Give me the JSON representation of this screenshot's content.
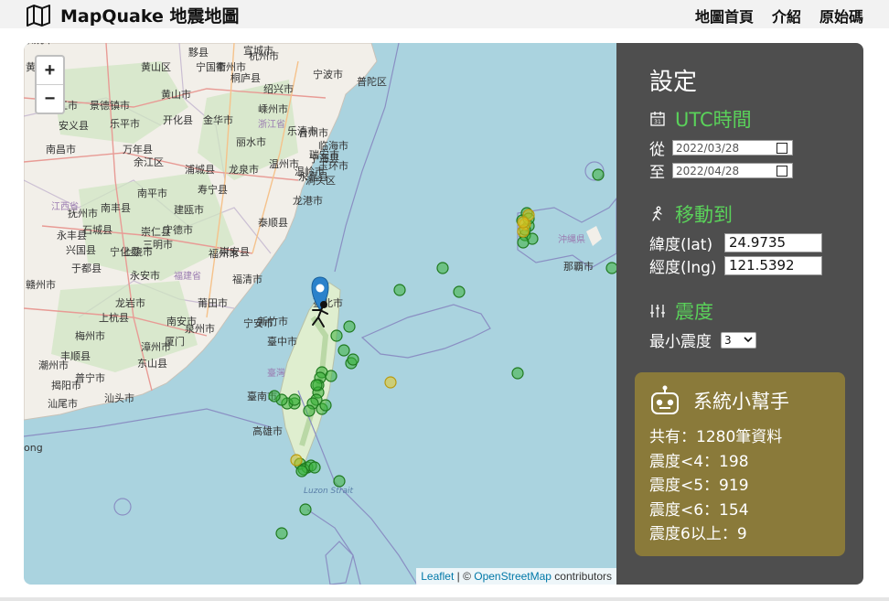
{
  "header": {
    "brand": "MapQuake 地震地圖",
    "nav": [
      "地圖首頁",
      "介紹",
      "原始碼"
    ]
  },
  "map": {
    "zoom_in": "+",
    "zoom_out": "−",
    "attribution": {
      "leaflet": "Leaflet",
      "sep": " | © ",
      "osm": "OpenStreetMap",
      "tail": " contributors"
    },
    "labels": [
      {
        "t": "黄",
        "k": "city"
      },
      {
        "t": "九江市",
        "k": "city"
      },
      {
        "t": "南昌市",
        "k": "city"
      },
      {
        "t": "抚州市",
        "k": "city"
      },
      {
        "t": "景德镇市",
        "k": "city"
      },
      {
        "t": "上饶市",
        "k": "city"
      },
      {
        "t": "南平市",
        "k": "city"
      },
      {
        "t": "宁德市",
        "k": "city"
      },
      {
        "t": "福州市",
        "k": "city"
      },
      {
        "t": "福清市",
        "k": "city"
      },
      {
        "t": "莆田市",
        "k": "city"
      },
      {
        "t": "泉州市",
        "k": "city"
      },
      {
        "t": "漳州市",
        "k": "city"
      },
      {
        "t": "厦门",
        "k": "city"
      },
      {
        "t": "龙岩市",
        "k": "city"
      },
      {
        "t": "三明市",
        "k": "city"
      },
      {
        "t": "梅州市",
        "k": "city"
      },
      {
        "t": "汕头市",
        "k": "city"
      },
      {
        "t": "汕尾市",
        "k": "city"
      },
      {
        "t": "揭阳市",
        "k": "city"
      },
      {
        "t": "赣州市",
        "k": "city"
      },
      {
        "t": "金华市",
        "k": "city"
      },
      {
        "t": "丽水市",
        "k": "city"
      },
      {
        "t": "温州市",
        "k": "city"
      },
      {
        "t": "台州市",
        "k": "city"
      },
      {
        "t": "宁海县",
        "k": "city"
      },
      {
        "t": "绍兴市",
        "k": "city"
      },
      {
        "t": "杭州市",
        "k": "city"
      },
      {
        "t": "宁波市",
        "k": "city"
      },
      {
        "t": "衢州市",
        "k": "city"
      },
      {
        "t": "黄山市",
        "k": "city"
      },
      {
        "t": "龙泉市",
        "k": "city"
      },
      {
        "t": "瑞安市",
        "k": "city"
      },
      {
        "t": "龙港市",
        "k": "city"
      },
      {
        "t": "洞头区",
        "k": "city"
      },
      {
        "t": "臺北市",
        "k": "city"
      },
      {
        "t": "新竹市",
        "k": "city"
      },
      {
        "t": "臺中市",
        "k": "city"
      },
      {
        "t": "臺南市",
        "k": "city"
      },
      {
        "t": "高雄市",
        "k": "city"
      },
      {
        "t": "臺灣",
        "k": "region"
      },
      {
        "t": "沖縄県",
        "k": "region"
      },
      {
        "t": "那覇市",
        "k": "city"
      },
      {
        "t": "江西省",
        "k": "region"
      },
      {
        "t": "福建省",
        "k": "region"
      },
      {
        "t": "浙江省",
        "k": "region"
      },
      {
        "t": "Luzon Strait",
        "k": "sea"
      },
      {
        "t": "ong",
        "k": "city"
      },
      {
        "t": "上杭县",
        "k": "city"
      },
      {
        "t": "东山县",
        "k": "city"
      },
      {
        "t": "永安市",
        "k": "city"
      },
      {
        "t": "建瓯市",
        "k": "city"
      },
      {
        "t": "寿宁县",
        "k": "city"
      },
      {
        "t": "浦城县",
        "k": "city"
      },
      {
        "t": "开化县",
        "k": "city"
      },
      {
        "t": "万年县",
        "k": "city"
      },
      {
        "t": "乐平市",
        "k": "city"
      },
      {
        "t": "安义县",
        "k": "city"
      },
      {
        "t": "南丰县",
        "k": "city"
      },
      {
        "t": "宁化县",
        "k": "city"
      },
      {
        "t": "兴国县",
        "k": "city"
      },
      {
        "t": "于都县",
        "k": "city"
      },
      {
        "t": "永丰县",
        "k": "city"
      },
      {
        "t": "普陀区",
        "k": "city"
      },
      {
        "t": "嵊州市",
        "k": "city"
      },
      {
        "t": "桐庐县",
        "k": "city"
      },
      {
        "t": "黄山区",
        "k": "city"
      },
      {
        "t": "宁国市",
        "k": "city"
      },
      {
        "t": "宣城市",
        "k": "city"
      },
      {
        "t": "黟县",
        "k": "city"
      },
      {
        "t": "余江区",
        "k": "city"
      },
      {
        "t": "石城县",
        "k": "city"
      },
      {
        "t": "南安市",
        "k": "city"
      },
      {
        "t": "潮州市",
        "k": "city"
      },
      {
        "t": "普宁市",
        "k": "city"
      },
      {
        "t": "丰顺县",
        "k": "city"
      },
      {
        "t": "玉环市",
        "k": "city"
      },
      {
        "t": "泰顺县",
        "k": "city"
      },
      {
        "t": "宁安市",
        "k": "city"
      },
      {
        "t": "崇仁县",
        "k": "city"
      },
      {
        "t": "永嘉县",
        "k": "city"
      },
      {
        "t": "崇安县",
        "k": "city"
      },
      {
        "t": "乐清市",
        "k": "city"
      },
      {
        "t": "临海市",
        "k": "city"
      },
      {
        "t": "温岭市",
        "k": "city"
      },
      {
        "t": "余姚市",
        "k": "city"
      }
    ],
    "markers_count": {
      "green": 44,
      "yellow": 6
    },
    "colors": {
      "sea": "#aad3df",
      "land": "#f2efe9",
      "green": "#3bb33b",
      "yellow": "#e8c821",
      "pin": "#2b82cb"
    }
  },
  "panel": {
    "title": "設定",
    "utc": {
      "title": "UTC時間",
      "from_label": "從",
      "from_value": "2022/03/28",
      "to_label": "至",
      "to_value": "2022/04/28"
    },
    "move": {
      "title": "移動到",
      "lat_label": "緯度(lat)",
      "lat_value": "24.9735",
      "lng_label": "經度(lng)",
      "lng_value": "121.5392"
    },
    "mag": {
      "title": "震度",
      "min_label": "最小震度",
      "min_value": "3"
    },
    "helper": {
      "title": "系統小幫手",
      "lines": [
        "共有：1280筆資料",
        "震度<4：198",
        "震度<5：919",
        "震度<6：154",
        "震度6以上：9"
      ]
    }
  }
}
